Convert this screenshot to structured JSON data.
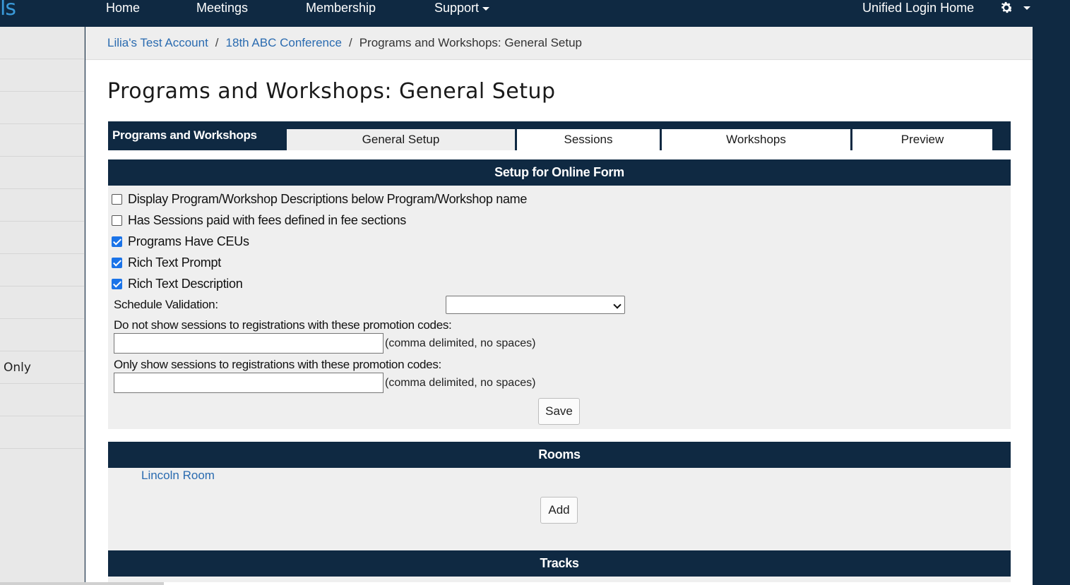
{
  "brand": {
    "text": "ls"
  },
  "nav": {
    "home": "Home",
    "meetings": "Meetings",
    "membership": "Membership",
    "support": "Support",
    "unified_login": "Unified Login Home",
    "settings_icon": "gear-icon"
  },
  "sidebar": {
    "items": [
      "",
      "",
      "",
      "",
      "",
      "",
      "",
      "",
      "",
      "",
      "Only",
      "",
      "",
      ""
    ]
  },
  "breadcrumb": {
    "items": [
      "Lilia's Test Account",
      "18th ABC Conference"
    ],
    "separator": "/",
    "current": "Programs and Workshops: General Setup"
  },
  "page_title": "Programs and Workshops: General Setup",
  "tabbar": {
    "label": "Programs and Workshops",
    "tabs": [
      {
        "label": "General Setup",
        "active": true
      },
      {
        "label": "Sessions",
        "active": false
      },
      {
        "label": "Workshops",
        "active": false
      },
      {
        "label": "Preview",
        "active": false
      }
    ]
  },
  "setup_section": {
    "title": "Setup for Online Form",
    "checkboxes": [
      {
        "label": "Display Program/Workshop Descriptions below Program/Workshop name",
        "checked": false
      },
      {
        "label": "Has Sessions paid with fees defined in fee sections",
        "checked": false
      },
      {
        "label": "Programs Have CEUs",
        "checked": true
      },
      {
        "label": "Rich Text Prompt",
        "checked": true
      },
      {
        "label": "Rich Text Description",
        "checked": true
      }
    ],
    "schedule_validation_label": "Schedule Validation:",
    "schedule_validation_value": "",
    "hide_codes_label": "Do not show sessions to registrations with these promotion codes:",
    "hide_codes_value": "",
    "hide_codes_hint": "(comma delimited, no spaces)",
    "show_codes_label": "Only show sessions to registrations with these promotion codes:",
    "show_codes_value": "",
    "show_codes_hint": "(comma delimited, no spaces)",
    "save_label": "Save"
  },
  "rooms_section": {
    "title": "Rooms",
    "rooms": [
      "Lincoln Room"
    ],
    "add_label": "Add"
  },
  "tracks_section": {
    "title": "Tracks"
  },
  "colors": {
    "navy": "#0f2942",
    "link": "#2a6bb0",
    "panel": "#efefef",
    "checkbox": "#1a73e8"
  }
}
